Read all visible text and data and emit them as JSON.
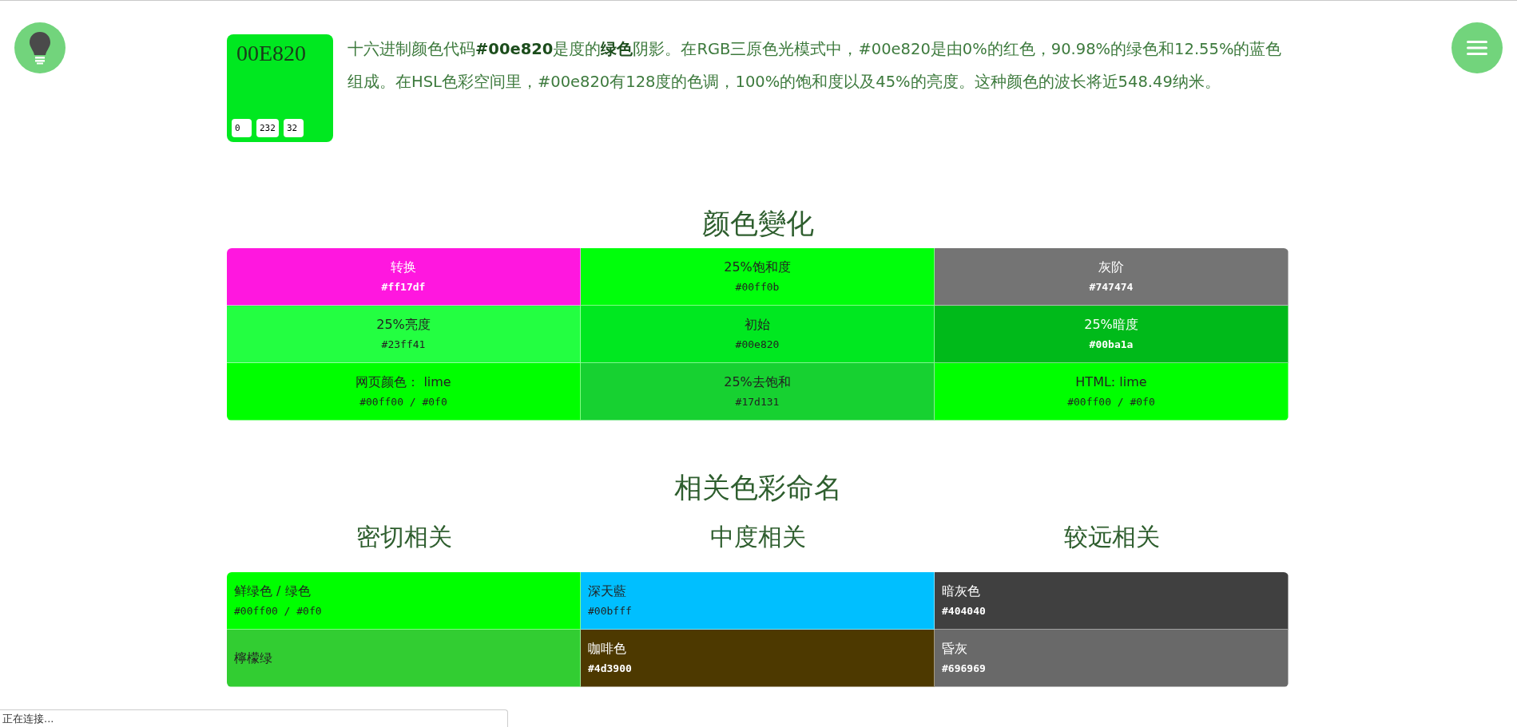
{
  "swatch": {
    "hex": "00E820",
    "color": "#00e820",
    "rgb": [
      "0",
      "232",
      "32"
    ]
  },
  "description": "十六进制颜色代码**#00e820**是度的**绿色**阴影。在RGB三原色光模式中，#00e820是由0%的红色，90.98%的绿色和12.55%的蓝色组成。在HSL色彩空间里，#00e820有128度的色调，100%的饱和度以及45%的亮度。这种颜色的波长将近548.49纳米。",
  "variations": {
    "title": "颜色變化",
    "items": [
      {
        "label": "转换",
        "hex": "#ff17df",
        "color": "#ff17df",
        "light_text": true
      },
      {
        "label": "25%饱和度",
        "hex": "#00ff0b",
        "color": "#00ff0b",
        "light_text": false
      },
      {
        "label": "灰阶",
        "hex": "#747474",
        "color": "#747474",
        "light_text": true
      },
      {
        "label": "25%亮度",
        "hex": "#23ff41",
        "color": "#23ff41",
        "light_text": false
      },
      {
        "label": "初始",
        "hex": "#00e820",
        "color": "#00e820",
        "light_text": false
      },
      {
        "label": "25%暗度",
        "hex": "#00ba1a",
        "color": "#00ba1a",
        "light_text": true
      },
      {
        "label": "网页颜色： lime",
        "hex": "#00ff00 / #0f0",
        "color": "#00ff00",
        "light_text": false
      },
      {
        "label": "25%去饱和",
        "hex": "#17d131",
        "color": "#17d131",
        "light_text": false
      },
      {
        "label": "HTML: lime",
        "hex": "#00ff00 / #0f0",
        "color": "#00ff00",
        "light_text": false
      }
    ]
  },
  "related": {
    "title": "相关色彩命名",
    "columns": [
      "密切相关",
      "中度相关",
      "较远相关"
    ],
    "items": [
      {
        "label": "鲜绿色 / 绿色",
        "hex": "#00ff00 / #0f0",
        "color": "#00ff00",
        "light_text": false
      },
      {
        "label": "深天藍",
        "hex": "#00bfff",
        "color": "#00bfff",
        "light_text": false
      },
      {
        "label": "暗灰色",
        "hex": "#404040",
        "color": "#404040",
        "light_text": true
      },
      {
        "label": "檸檬绿",
        "color": "#32cd32",
        "light_text": false
      },
      {
        "label": "咖啡色",
        "hex": "#4d3900",
        "color": "#4d3900",
        "light_text": true
      },
      {
        "label": "昏灰",
        "hex": "#696969",
        "color": "#696969",
        "light_text": true
      }
    ]
  },
  "status_bar": "正在连接..."
}
